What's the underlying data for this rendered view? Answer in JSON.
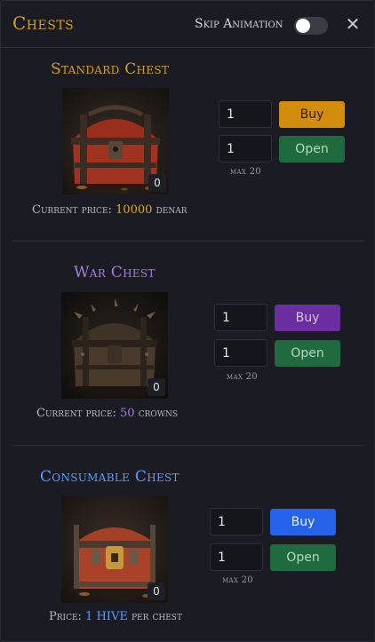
{
  "header": {
    "title": "Chests",
    "skip_animation_label": "Skip Animation",
    "skip_animation_on": false,
    "close_symbol": "✕"
  },
  "chests": [
    {
      "name": "Standard Chest",
      "title_color": "#d4a018",
      "owned_count": "0",
      "buy_qty": "1",
      "open_qty": "1",
      "buy_label": "Buy",
      "open_label": "Open",
      "max_label": "max 20",
      "price_prefix": "Current price:",
      "price_value": "10000",
      "price_suffix": "denar",
      "price_color": "#e0a91c",
      "buy_color": "#d38c0b"
    },
    {
      "name": "War Chest",
      "title_color": "#a97ae0",
      "owned_count": "0",
      "buy_qty": "1",
      "open_qty": "1",
      "buy_label": "Buy",
      "open_label": "Open",
      "max_label": "max 20",
      "price_prefix": "Current price:",
      "price_value": "50",
      "price_suffix": "crowns",
      "price_color": "#a97ae0",
      "buy_color": "#6a2ea0"
    },
    {
      "name": "Consumable Chest",
      "title_color": "#5b9cff",
      "owned_count": "0",
      "buy_qty": "1",
      "open_qty": "1",
      "buy_label": "Buy",
      "open_label": "Open",
      "max_label": "max 20",
      "price_prefix": "Price:",
      "price_value": "1 HIVE",
      "price_suffix": "per chest",
      "price_color": "#5b9cff",
      "buy_color": "#2563eb"
    }
  ],
  "colors": {
    "open_button": "#1f6a3e",
    "open_button_text": "#b9d7c3"
  }
}
